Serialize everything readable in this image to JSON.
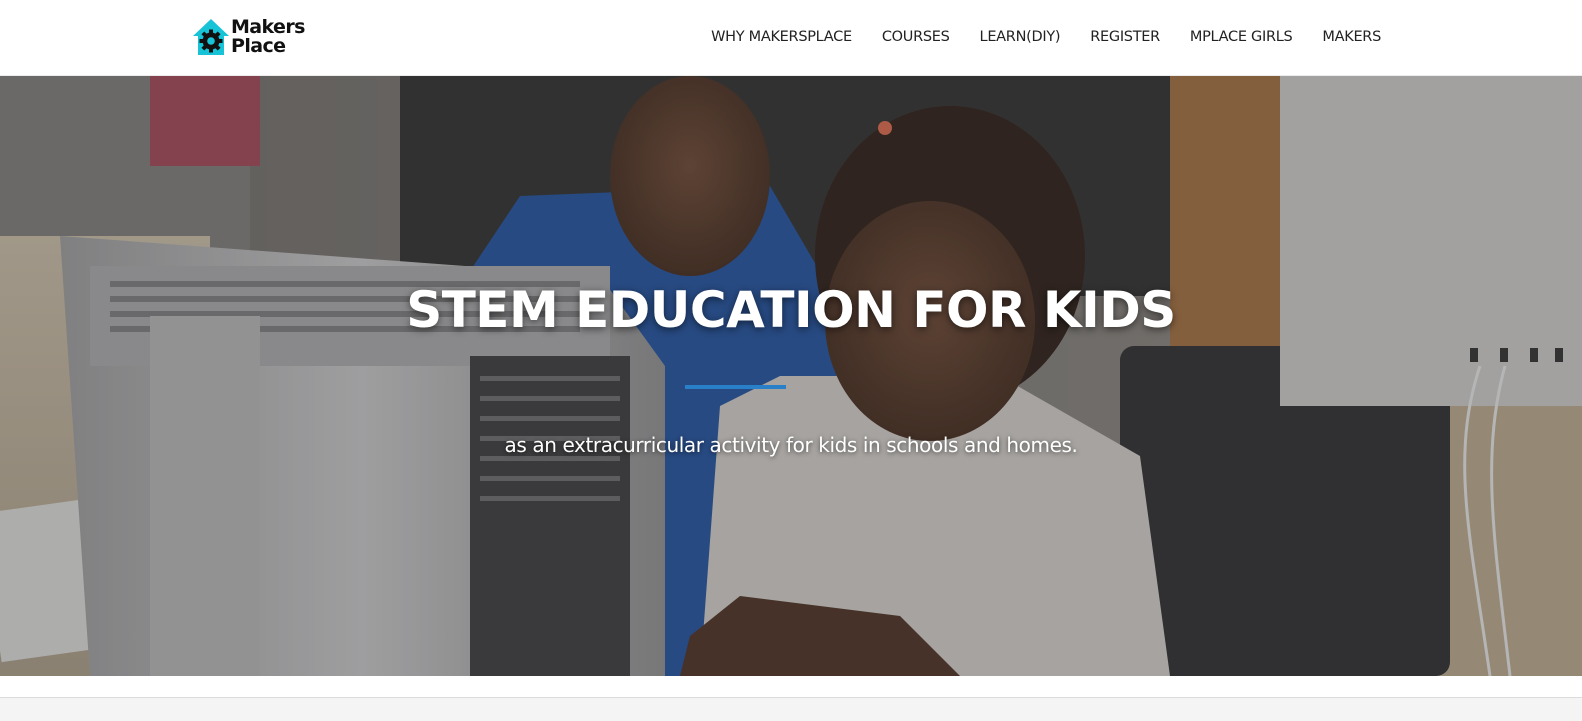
{
  "brand": {
    "logo_line1": "Makers",
    "logo_line2": "Place",
    "accent_color": "#17c3d6",
    "logo_icon": "house-gear-icon"
  },
  "nav": {
    "items": [
      {
        "label": "WHY MAKERSPLACE"
      },
      {
        "label": "COURSES"
      },
      {
        "label": "LEARN(DIY)"
      },
      {
        "label": "REGISTER"
      },
      {
        "label": "MPLACE GIRLS"
      },
      {
        "label": "MAKERS"
      }
    ]
  },
  "hero": {
    "title": "STEM EDUCATION FOR KIDS",
    "subtitle": "as an extracurricular activity for kids in schools and homes.",
    "divider_color": "#2a7fc9",
    "image": "photo-of-instructor-and-girl-at-computer"
  }
}
